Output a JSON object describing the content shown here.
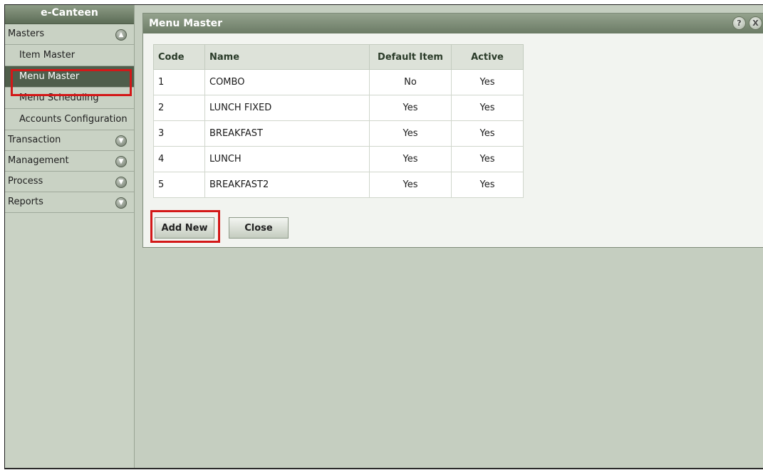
{
  "sidebar": {
    "title": "e-Canteen",
    "sections": [
      {
        "label": "Masters",
        "icon": "chevron-up-icon",
        "expanded": true
      },
      {
        "label": "Transaction",
        "icon": "chevron-down-icon",
        "expanded": false
      },
      {
        "label": "Management",
        "icon": "chevron-down-icon",
        "expanded": false
      },
      {
        "label": "Process",
        "icon": "chevron-down-icon",
        "expanded": false
      },
      {
        "label": "Reports",
        "icon": "chevron-down-icon",
        "expanded": false
      }
    ],
    "masters_items": [
      "Item Master",
      "Menu Master",
      "Menu Scheduling",
      "Accounts Configuration"
    ],
    "selected_item": "Menu Master"
  },
  "panel": {
    "title": "Menu Master",
    "help_glyph": "?",
    "close_glyph": "X"
  },
  "table": {
    "headers": [
      "Code",
      "Name",
      "Default Item",
      "Active"
    ],
    "rows": [
      [
        "1",
        "COMBO",
        "No",
        "Yes"
      ],
      [
        "2",
        "LUNCH FIXED",
        "Yes",
        "Yes"
      ],
      [
        "3",
        "BREAKFAST",
        "Yes",
        "Yes"
      ],
      [
        "4",
        "LUNCH",
        "Yes",
        "Yes"
      ],
      [
        "5",
        "BREAKFAST2",
        "Yes",
        "Yes"
      ]
    ]
  },
  "buttons": {
    "add_new": "Add New",
    "close": "Close"
  },
  "colors": {
    "highlight": "#d31818",
    "title_bar": "#6b7b65",
    "active_item_bg": "#4f5e4b"
  }
}
